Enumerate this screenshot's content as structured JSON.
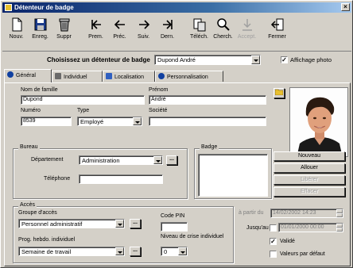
{
  "window": {
    "title": "Détenteur de badge",
    "close_glyph": "×"
  },
  "toolbar": {
    "buttons": [
      {
        "label": "Nouv.",
        "icon": "new-document-icon",
        "enabled": true
      },
      {
        "label": "Enreg.",
        "icon": "save-icon",
        "enabled": true
      },
      {
        "label": "Suppr",
        "icon": "trash-icon",
        "enabled": true
      },
      {
        "label": "Prem.",
        "icon": "first-record-icon",
        "enabled": true
      },
      {
        "label": "Préc.",
        "icon": "previous-icon",
        "enabled": true
      },
      {
        "label": "Suiv.",
        "icon": "next-icon",
        "enabled": true
      },
      {
        "label": "Dern.",
        "icon": "last-record-icon",
        "enabled": true
      },
      {
        "label": "Téléch.",
        "icon": "download-icon",
        "enabled": true
      },
      {
        "label": "Cherch.",
        "icon": "search-icon",
        "enabled": true
      },
      {
        "label": "Accept.",
        "icon": "accept-icon",
        "enabled": false
      },
      {
        "label": "Fermer",
        "icon": "exit-icon",
        "enabled": true
      }
    ]
  },
  "selector": {
    "label": "Choisissez un détenteur de badge",
    "value": "Dupond André",
    "show_photo_label": "Affichage photo",
    "show_photo_checked": true
  },
  "tabs": [
    {
      "label": "Général",
      "active": true,
      "icon": "info-icon"
    },
    {
      "label": "Individuel",
      "active": false,
      "icon": "id-card-icon"
    },
    {
      "label": "Localisation",
      "active": false,
      "icon": "location-icon"
    },
    {
      "label": "Personnalisation",
      "active": false,
      "icon": "customize-icon"
    }
  ],
  "general": {
    "last_name_label": "Nom de famille",
    "last_name": "Dupond",
    "first_name_label": "Prénom",
    "first_name": "André",
    "number_label": "Numéro",
    "number": "8539",
    "type_label": "Type",
    "type_value": "Employé",
    "company_label": "Société",
    "company": ""
  },
  "bureau": {
    "caption": "Bureau",
    "department_label": "Département",
    "department_value": "Administration",
    "phone_label": "Téléphone",
    "phone_value": ""
  },
  "badge": {
    "caption": "Badge",
    "buttons": [
      {
        "label": "Nouveau",
        "enabled": true
      },
      {
        "label": "Allouer",
        "enabled": true
      },
      {
        "label": "Libérer",
        "enabled": false
      },
      {
        "label": "Effacer",
        "enabled": false
      }
    ]
  },
  "access": {
    "caption": "Accès",
    "group_label": "Groupe d'accès",
    "group_value": "Personnel administratif",
    "pin_label": "Code PIN",
    "pin_value": "",
    "schedule_label": "Prog. hebdo. individuel",
    "schedule_value": "Semaine de travail",
    "crisis_label": "Niveau de crise individuel",
    "crisis_value": "0",
    "ellipsis": "..."
  },
  "validity": {
    "from_label": "à partir du",
    "from_value": "14/02/2002 14:23",
    "until_label": "Jusqu'au",
    "until_value": "01/01/2000 00:00",
    "valid_label": "Validé",
    "valid_checked": true,
    "defaults_label": "Valeurs par défaut",
    "defaults_checked": false
  },
  "check_glyph": "✓"
}
